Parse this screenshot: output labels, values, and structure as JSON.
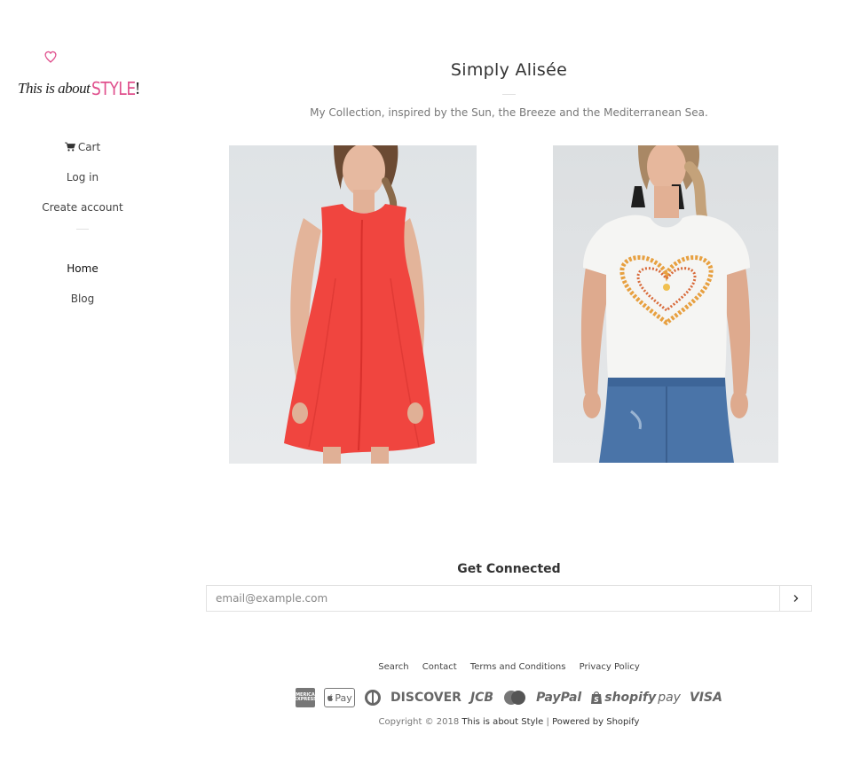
{
  "sidebar": {
    "logo": {
      "lead_text": "This is about",
      "brand_text": "STYLE",
      "suffix_text": "!"
    },
    "nav": {
      "cart_label": "Cart",
      "login_label": "Log in",
      "create_account_label": "Create account",
      "home_label": "Home",
      "blog_label": "Blog"
    }
  },
  "main": {
    "title": "Simply Alisée",
    "subtitle": "My Collection, inspired by the Sun, the Breeze and the Mediterranean Sea."
  },
  "newsletter": {
    "title": "Get Connected",
    "placeholder": "email@example.com"
  },
  "footer": {
    "links": [
      "Search",
      "Contact",
      "Terms and Conditions",
      "Privacy Policy"
    ],
    "payments": {
      "amex": "AMERICAN EXPRESS",
      "apple_pay": "Pay",
      "discover": "DISCOVER",
      "jcb": "JCB",
      "paypal": "PayPal",
      "shopify_bold": "shopify",
      "shopify_thin": "pay",
      "visa": "VISA"
    },
    "copyright_prefix": "Copyright © 2018",
    "store_name": "This is about Style",
    "separator": "|",
    "powered_by": "Powered by Shopify"
  },
  "colors": {
    "brand_pink": "#e0508d",
    "text": "#333333",
    "dress_red": "#f0453f",
    "photo_bg": "#e4e7ea"
  }
}
